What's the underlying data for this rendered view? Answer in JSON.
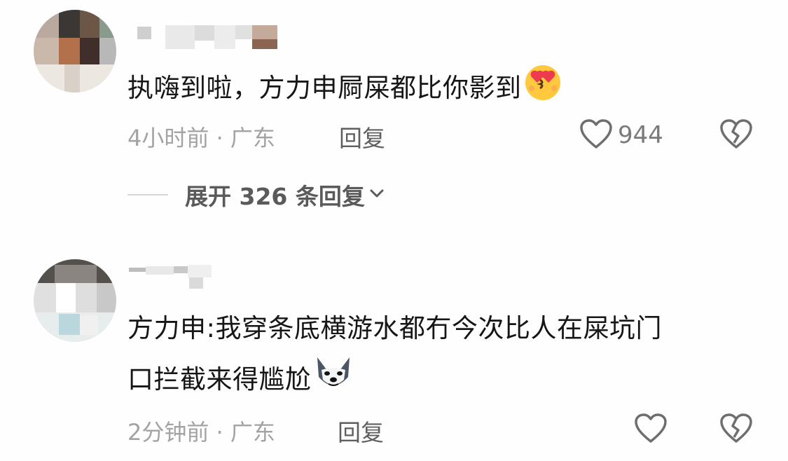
{
  "comments": [
    {
      "text": "执嗨到啦，方力申屙屎都比你影到",
      "time_location": "4小时前 · 广东",
      "reply_label": "回复",
      "like_count": "944",
      "emoji": "heart-eyes-kiss-emoji"
    },
    {
      "text_line1": "方力申:我穿条底横游水都冇今次比人在屎坑门",
      "text_line2": "口拦截来得尴尬",
      "time_location": "2分钟前 · 广东",
      "reply_label": "回复",
      "like_count": "",
      "emoji": "husky-dog-emoji"
    }
  ],
  "expand_replies": {
    "label": "展开 326 条回复"
  },
  "colors": {
    "background": "#fefefe",
    "meta_text": "#a3a3a3",
    "reply_text": "#5f5f5f",
    "icon_stroke": "#6e6e6e"
  }
}
